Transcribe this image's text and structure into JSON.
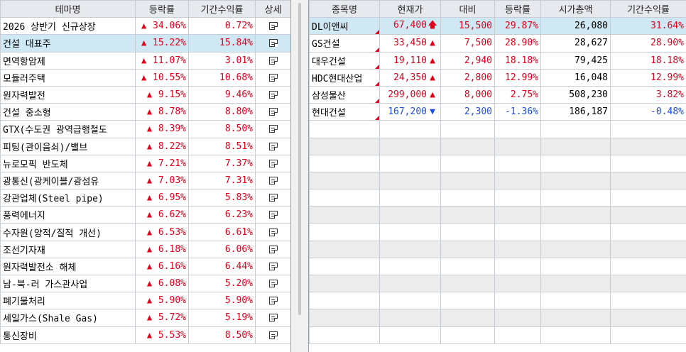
{
  "left": {
    "headers": [
      "테마명",
      "등락률",
      "기간수익률",
      "상세"
    ],
    "rows": [
      {
        "theme": "2026 상반기 신규상장",
        "change": "34.06%",
        "period": "0.72%",
        "selected": false
      },
      {
        "theme": "건설 대표주",
        "change": "15.22%",
        "period": "15.84%",
        "selected": true
      },
      {
        "theme": "면역항암제",
        "change": "11.07%",
        "period": "3.01%",
        "selected": false
      },
      {
        "theme": "모듈러주택",
        "change": "10.55%",
        "period": "10.68%",
        "selected": false
      },
      {
        "theme": "원자력발전",
        "change": "9.15%",
        "period": "9.46%",
        "selected": false
      },
      {
        "theme": "건설 중소형",
        "change": "8.78%",
        "period": "8.80%",
        "selected": false
      },
      {
        "theme": "GTX(수도권 광역급행철도",
        "change": "8.39%",
        "period": "8.50%",
        "selected": false
      },
      {
        "theme": "피팅(관이음쇠)/밸브",
        "change": "8.22%",
        "period": "8.51%",
        "selected": false
      },
      {
        "theme": "뉴로모픽 반도체",
        "change": "7.21%",
        "period": "7.37%",
        "selected": false
      },
      {
        "theme": "광통신(광케이블/광섬유",
        "change": "7.03%",
        "period": "7.31%",
        "selected": false
      },
      {
        "theme": "강관업체(Steel pipe)",
        "change": "6.95%",
        "period": "5.83%",
        "selected": false
      },
      {
        "theme": "풍력에너지",
        "change": "6.62%",
        "period": "6.23%",
        "selected": false
      },
      {
        "theme": "수자원(양적/질적 개선)",
        "change": "6.53%",
        "period": "6.61%",
        "selected": false
      },
      {
        "theme": "조선기자재",
        "change": "6.18%",
        "period": "6.06%",
        "selected": false
      },
      {
        "theme": "원자력발전소 해체",
        "change": "6.16%",
        "period": "6.44%",
        "selected": false
      },
      {
        "theme": "남-북-러 가스관사업",
        "change": "6.08%",
        "period": "5.20%",
        "selected": false
      },
      {
        "theme": "폐기물처리",
        "change": "5.90%",
        "period": "5.90%",
        "selected": false
      },
      {
        "theme": "셰일가스(Shale Gas)",
        "change": "5.72%",
        "period": "5.19%",
        "selected": false
      },
      {
        "theme": "통신장비",
        "change": "5.53%",
        "period": "8.50%",
        "selected": false
      }
    ],
    "up_symbol": "▲",
    "detail_icon": "document-icon"
  },
  "right": {
    "headers": [
      "종목명",
      "현재가",
      "대비",
      "등락률",
      "시가총액",
      "기간수익률"
    ],
    "rows": [
      {
        "name": "DL이앤씨",
        "price": "67,400",
        "direction": "up-limit",
        "diff": "15,500",
        "change": "29.87%",
        "cap": "26,080",
        "period": "31.64%",
        "selected": true
      },
      {
        "name": "GS건설",
        "price": "33,450",
        "direction": "up",
        "diff": "7,500",
        "change": "28.90%",
        "cap": "28,627",
        "period": "28.90%",
        "selected": false
      },
      {
        "name": "대우건설",
        "price": "19,110",
        "direction": "up",
        "diff": "2,940",
        "change": "18.18%",
        "cap": "79,425",
        "period": "18.18%",
        "selected": false
      },
      {
        "name": "HDC현대산업",
        "price": "24,350",
        "direction": "up",
        "diff": "2,800",
        "change": "12.99%",
        "cap": "16,048",
        "period": "12.99%",
        "selected": false
      },
      {
        "name": "삼성물산",
        "price": "299,000",
        "direction": "up",
        "diff": "8,000",
        "change": "2.75%",
        "cap": "508,230",
        "period": "3.82%",
        "selected": false
      },
      {
        "name": "현대건설",
        "price": "167,200",
        "direction": "down",
        "diff": "2,300",
        "change": "-1.36%",
        "cap": "186,187",
        "period": "-0.48%",
        "selected": false
      }
    ],
    "empty_rows": 13,
    "symbols": {
      "up": "▲",
      "up-limit": "🡅",
      "down": "▼"
    },
    "colors": {
      "up": "#e0001b",
      "down": "#1b4ee6",
      "selected": "#cfe8f4"
    }
  }
}
